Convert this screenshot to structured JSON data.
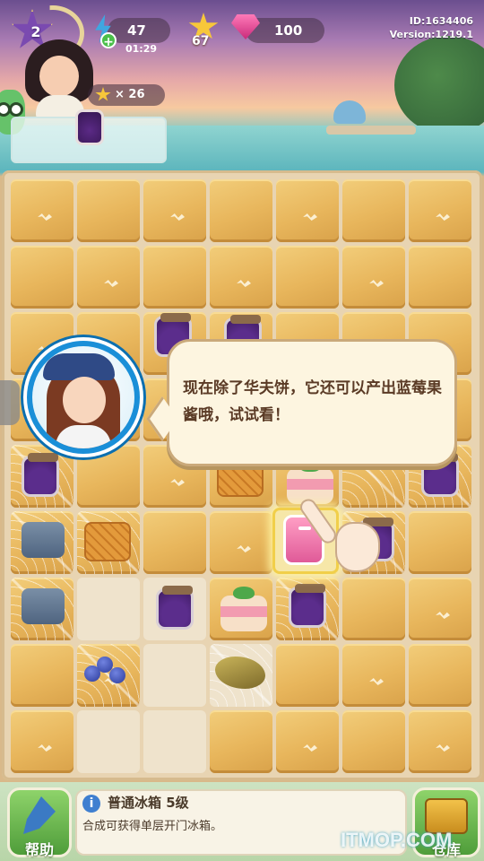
{
  "hud": {
    "level": "2",
    "energy": "47",
    "energy_timer": "01:29",
    "stars": "67",
    "gems": "100",
    "player_id": "ID:1634406",
    "version": "Version:1219.1",
    "order_star_reward": "× 26",
    "icons": [
      "level-star-icon",
      "energy-bolt-icon",
      "plus-icon",
      "star-icon",
      "gem-icon"
    ]
  },
  "tutorial": {
    "message": "现在除了华夫饼，它还可以产出蓝莓果酱哦，试试看！"
  },
  "board": {
    "columns": 7,
    "rows": 9,
    "highlighted_item": "fridge-pink"
  },
  "bottom": {
    "help_label": "帮助",
    "item_title": "普通冰箱 5级",
    "item_desc": "合成可获得单层开门冰箱。",
    "store_label": "仓库",
    "watermark": "ITMOP.COM"
  },
  "colors": {
    "tile": "#e8b65c",
    "bubble": "#fdf5e0",
    "npc_ring": "#1a8fd8",
    "button_green": "#4f9d3a"
  }
}
